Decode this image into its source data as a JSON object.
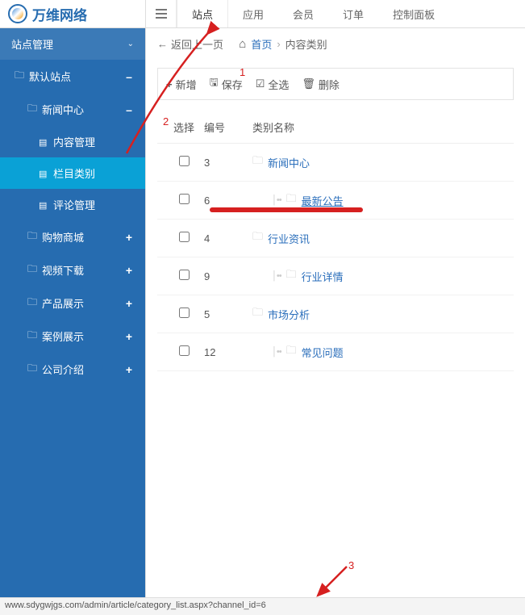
{
  "brand": "万维网络",
  "sidebar": {
    "section": "站点管理",
    "items": [
      {
        "label": "默认站点",
        "level": 1,
        "toggle": "–",
        "icon": "folder"
      },
      {
        "label": "新闻中心",
        "level": 2,
        "toggle": "–",
        "icon": "folder"
      },
      {
        "label": "内容管理",
        "level": 3,
        "toggle": "",
        "icon": "doc"
      },
      {
        "label": "栏目类别",
        "level": 3,
        "toggle": "",
        "icon": "doc",
        "active": true
      },
      {
        "label": "评论管理",
        "level": 3,
        "toggle": "",
        "icon": "doc"
      },
      {
        "label": "购物商城",
        "level": 2,
        "toggle": "+",
        "icon": "folder"
      },
      {
        "label": "视频下载",
        "level": 2,
        "toggle": "+",
        "icon": "folder"
      },
      {
        "label": "产品展示",
        "level": 2,
        "toggle": "+",
        "icon": "folder"
      },
      {
        "label": "案例展示",
        "level": 2,
        "toggle": "+",
        "icon": "folder"
      },
      {
        "label": "公司介绍",
        "level": 2,
        "toggle": "+",
        "icon": "folder"
      }
    ]
  },
  "topnav": {
    "tabs": [
      {
        "label": "站点",
        "active": true
      },
      {
        "label": "应用"
      },
      {
        "label": "会员"
      },
      {
        "label": "订单"
      },
      {
        "label": "控制面板"
      }
    ]
  },
  "breadcrumb": {
    "back": "返回上一页",
    "home": "首页",
    "current": "内容类别"
  },
  "toolbar": {
    "add": "新增",
    "save": "保存",
    "select_all": "全选",
    "delete": "删除"
  },
  "grid": {
    "headers": {
      "select": "选择",
      "id": "编号",
      "name": "类别名称"
    },
    "rows": [
      {
        "id": "3",
        "name": "新闻中心",
        "indent": false,
        "underline": false
      },
      {
        "id": "6",
        "name": "最新公告",
        "indent": true,
        "underline": true
      },
      {
        "id": "4",
        "name": "行业资讯",
        "indent": false,
        "underline": false
      },
      {
        "id": "9",
        "name": "行业详情",
        "indent": true,
        "underline": false
      },
      {
        "id": "5",
        "name": "市场分析",
        "indent": false,
        "underline": false
      },
      {
        "id": "12",
        "name": "常见问题",
        "indent": true,
        "underline": false
      }
    ]
  },
  "annotations": {
    "n1": "1",
    "n2": "2",
    "n3": "3"
  },
  "statusbar": "www.sdygwjgs.com/admin/article/category_list.aspx?channel_id=6"
}
